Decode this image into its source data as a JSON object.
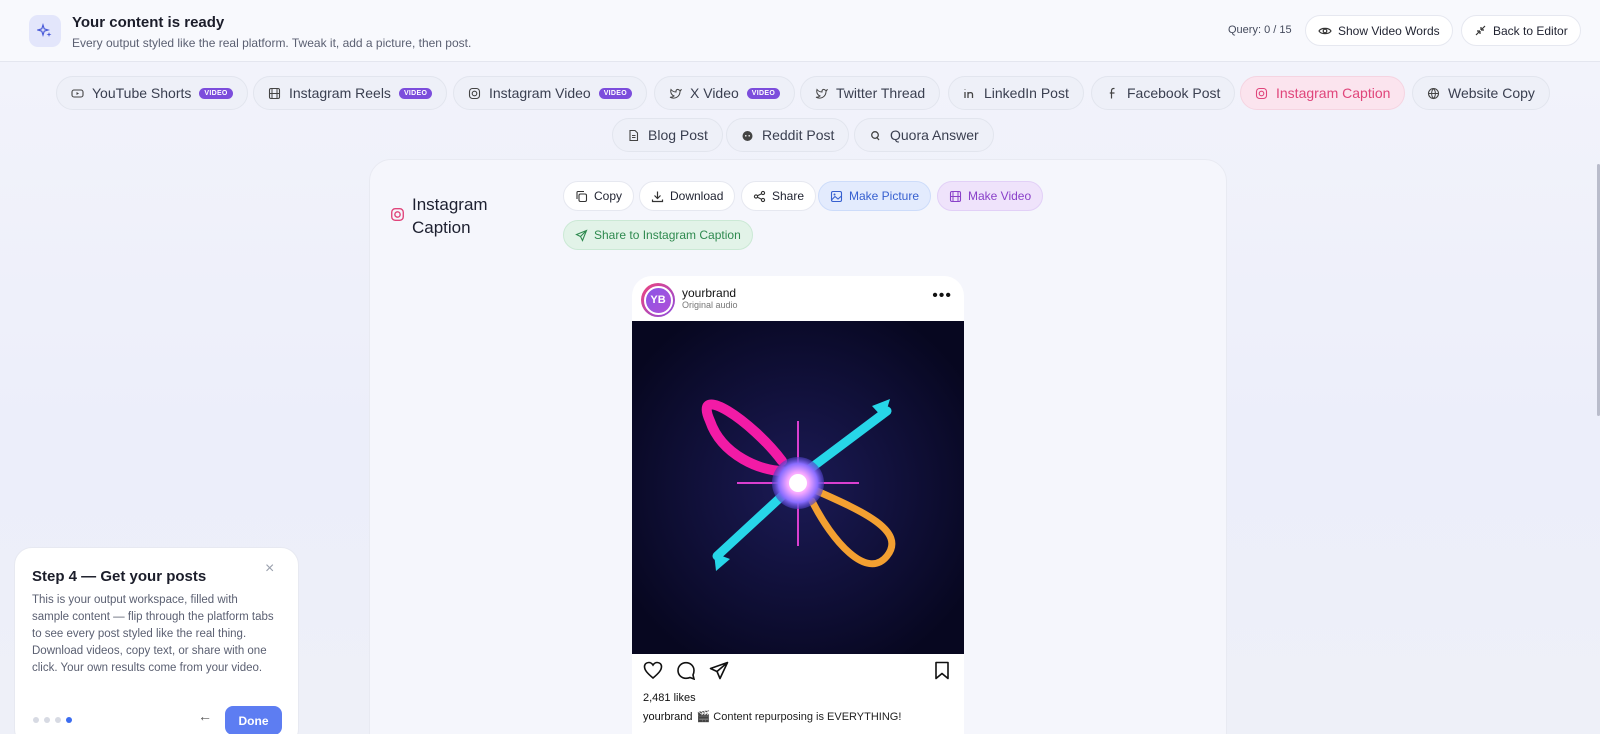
{
  "header": {
    "title": "Your content is ready",
    "subtitle": "Every output styled like the real platform. Tweak it, add a picture, then post.",
    "query": "Query: 0 / 15",
    "show_words_label": "Show Video Words",
    "back_label": "Back to Editor"
  },
  "tabs": [
    {
      "label": "YouTube Shorts",
      "badge": "VIDEO"
    },
    {
      "label": "Instagram Reels",
      "badge": "VIDEO"
    },
    {
      "label": "Instagram Video",
      "badge": "VIDEO"
    },
    {
      "label": "X Video",
      "badge": "VIDEO"
    },
    {
      "label": "Twitter Thread"
    },
    {
      "label": "LinkedIn Post"
    },
    {
      "label": "Facebook Post"
    },
    {
      "label": "Instagram Caption",
      "active": true
    },
    {
      "label": "Website Copy"
    },
    {
      "label": "Blog Post"
    },
    {
      "label": "Reddit Post"
    },
    {
      "label": "Quora Answer"
    }
  ],
  "card": {
    "title": "Instagram Caption",
    "actions": {
      "copy": "Copy",
      "download": "Download",
      "share": "Share",
      "make_picture": "Make Picture",
      "make_video": "Make Video",
      "share_to": "Share to Instagram Caption"
    }
  },
  "post": {
    "avatar_initials": "YB",
    "username": "yourbrand",
    "audio": "Original audio",
    "likes": "2,481 likes",
    "caption_user": "yourbrand",
    "caption_text": "🎬 Content repurposing is EVERYTHING!"
  },
  "tour": {
    "title": "Step 4 — Get your posts",
    "body": "This is your output workspace, filled with sample content — flip through the platform tabs to see every post styled like the real thing. Download videos, copy text, or share with one click. Your own results come from your video.",
    "close": "×",
    "back": "←",
    "done": "Done",
    "step_current": 4,
    "step_total": 4
  },
  "colors": {
    "accent_pink": "#e0457b",
    "accent_blue": "#5d7df2",
    "video_badge": "#7c4ddc"
  }
}
